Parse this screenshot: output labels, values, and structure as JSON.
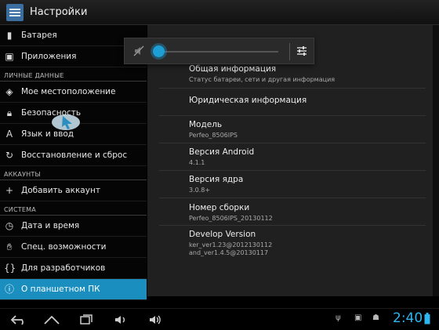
{
  "titlebar": {
    "title": "Настройки",
    "icon": "settings-icon"
  },
  "sidebar": {
    "items_top": [
      {
        "label": "Батарея",
        "icon": "battery-icon"
      },
      {
        "label": "Приложения",
        "icon": "apps-icon"
      }
    ],
    "section_personal": "ЛИЧНЫЕ ДАННЫЕ",
    "items_personal": [
      {
        "label": "Мое местоположение",
        "icon": "location-icon"
      },
      {
        "label": "Безопасность",
        "icon": "lock-icon"
      },
      {
        "label": "Язык и ввод",
        "icon": "language-icon"
      },
      {
        "label": "Восстановление и сброс",
        "icon": "backup-icon"
      }
    ],
    "section_accounts": "АККАУНТЫ",
    "items_accounts": [
      {
        "label": "Добавить аккаунт",
        "icon": "plus-icon"
      }
    ],
    "section_system": "СИСТЕМА",
    "items_system": [
      {
        "label": "Дата и время",
        "icon": "clock-icon"
      },
      {
        "label": "Спец. возможности",
        "icon": "hand-icon"
      },
      {
        "label": "Для разработчиков",
        "icon": "braces-icon"
      },
      {
        "label": "О планшетном ПК",
        "icon": "info-icon",
        "selected": true
      }
    ]
  },
  "content": {
    "items": [
      {
        "title": "Общая информация",
        "summary": "Статус батареи, сети и другая информация"
      },
      {
        "title": "Юридическая информация",
        "summary": ""
      },
      {
        "title": "Модель",
        "summary": "Perfeo_8506IPS"
      },
      {
        "title": "Версия Android",
        "summary": "4.1.1"
      },
      {
        "title": "Версия ядра",
        "summary": "3.0.8+"
      },
      {
        "title": "Номер сборки",
        "summary": "Perfeo_8506IPS_20130112"
      },
      {
        "title": "Develop Version",
        "summary": "ker_ver1.23@2012130112",
        "summary2": "and_ver1.4.5@20130117"
      }
    ]
  },
  "volume_popup": {
    "level_fraction": 0.0,
    "mute_icon": "volume-muted-icon",
    "settings_icon": "equalizer-icon"
  },
  "navbar": {
    "time": "2:40"
  },
  "colors": {
    "accent": "#1a8fbf",
    "clock": "#2fb6f0"
  }
}
